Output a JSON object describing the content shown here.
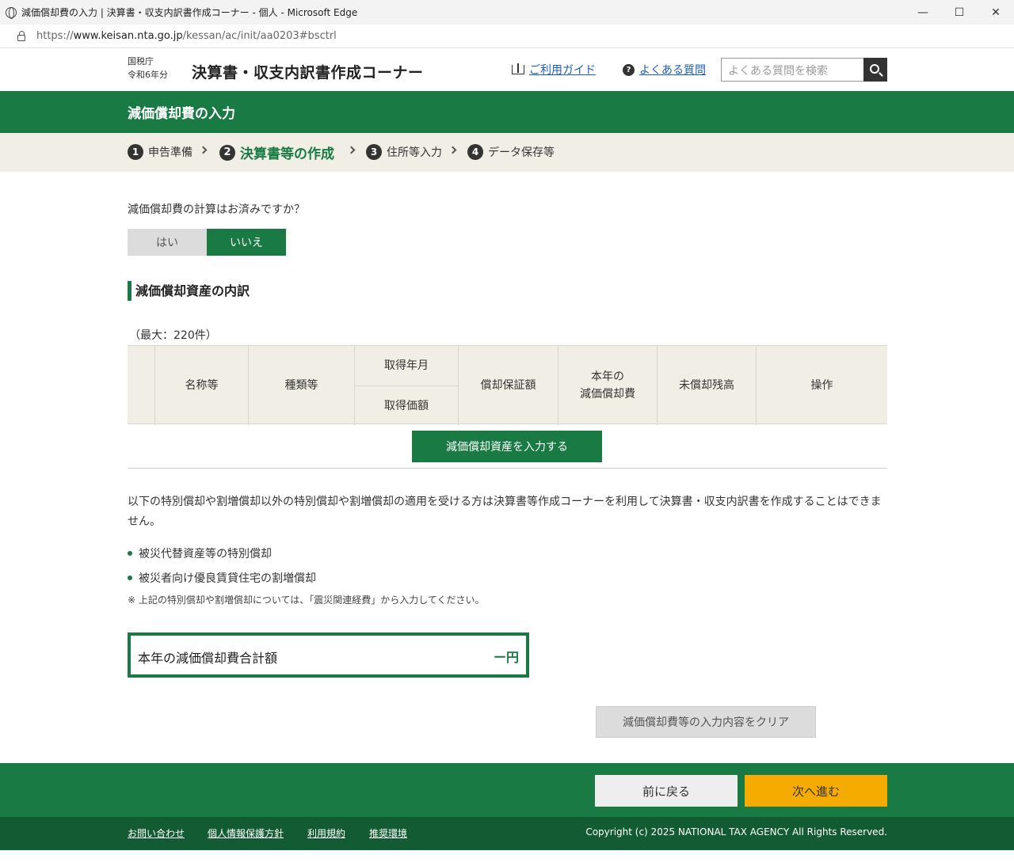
{
  "browser": {
    "window_title": "減価償却費の入力 | 決算書・収支内訳書作成コーナー - 個人 - Microsoft Edge",
    "url_prefix": "https://",
    "url_host": "www.keisan.nta.go.jp",
    "url_path": "/kessan/ac/init/aa0203#bsctrl",
    "minimize": "—",
    "maximize": "☐",
    "close": "✕"
  },
  "header": {
    "agency_line1": "国税庁",
    "agency_line2": "令和6年分",
    "site_title": "決算書・収支内訳書作成コーナー",
    "guide_label": "ご利用ガイド",
    "faq_label": "よくある質問",
    "search_placeholder": "よくある質問を検索"
  },
  "page": {
    "title": "減価償却費の入力"
  },
  "steps": [
    {
      "num": "1",
      "label": "申告準備"
    },
    {
      "num": "2",
      "label": "決算書等の作成"
    },
    {
      "num": "3",
      "label": "住所等入力"
    },
    {
      "num": "4",
      "label": "データ保存等"
    }
  ],
  "question": {
    "text": "減価償却費の計算はお済みですか？",
    "yes_label": "はい",
    "no_label": "いいえ"
  },
  "section": {
    "heading": "減価償却資産の内訳",
    "max_note": "（最大：220件）"
  },
  "table": {
    "headers": {
      "name": "名称等",
      "type": "種類等",
      "acquired_date": "取得年月",
      "acquired_value": "取得価額",
      "guarantee": "償却保証額",
      "current_line1": "本年の",
      "current_line2": "減価償却費",
      "remaining": "未償却残高",
      "ops": "操作"
    }
  },
  "add_button": "減価償却資産を入力する",
  "notice": {
    "paragraph": "以下の特別償却や割増償却以外の特別償却や割増償却の適用を受ける方は決算書等作成コーナーを利用して決算書・収支内訳書を作成することはできません。",
    "bullets": [
      "被災代替資産等の特別償却",
      "被災者向け優良賃貸住宅の割増償却"
    ],
    "note": "※ 上記の特別償却や割増償却については、「震災関連経費」から入力してください。"
  },
  "total": {
    "label": "本年の減価償却費合計額",
    "value": "ー円"
  },
  "clear_button": "減価償却費等の入力内容をクリア",
  "nav": {
    "back": "前に戻る",
    "next": "次へ進む"
  },
  "footer": {
    "links": [
      "お問い合わせ",
      "個人情報保護方針",
      "利用規約",
      "推奨環境"
    ],
    "copyright": "Copyright (c) 2025 NATIONAL TAX AGENCY All Rights Reserved."
  },
  "colors": {
    "brand_green": "#1a7a44",
    "dark_green": "#135c33",
    "accent_orange": "#f5ab00",
    "step_bg": "#f1efe5"
  }
}
